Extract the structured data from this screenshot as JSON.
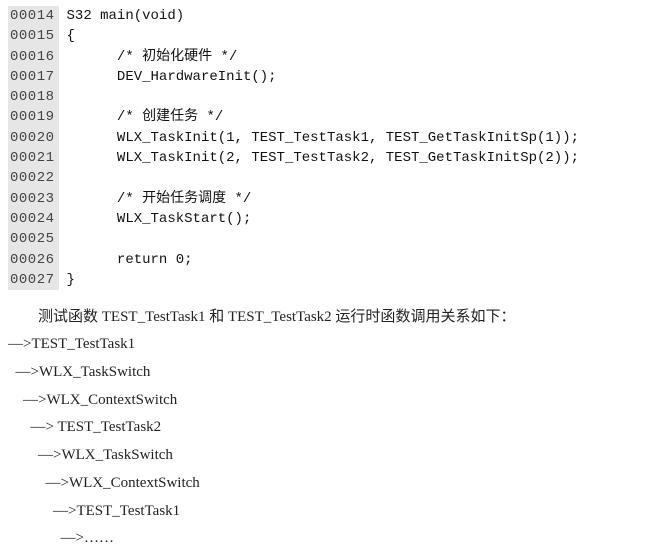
{
  "code": {
    "lines": [
      {
        "n": "00014",
        "t": "S32 main(void)"
      },
      {
        "n": "00015",
        "t": "{"
      },
      {
        "n": "00016",
        "t": "      /* 初始化硬件 */"
      },
      {
        "n": "00017",
        "t": "      DEV_HardwareInit();"
      },
      {
        "n": "00018",
        "t": ""
      },
      {
        "n": "00019",
        "t": "      /* 创建任务 */"
      },
      {
        "n": "00020",
        "t": "      WLX_TaskInit(1, TEST_TestTask1, TEST_GetTaskInitSp(1));"
      },
      {
        "n": "00021",
        "t": "      WLX_TaskInit(2, TEST_TestTask2, TEST_GetTaskInitSp(2));"
      },
      {
        "n": "00022",
        "t": ""
      },
      {
        "n": "00023",
        "t": "      /* 开始任务调度 */"
      },
      {
        "n": "00024",
        "t": "      WLX_TaskStart();"
      },
      {
        "n": "00025",
        "t": ""
      },
      {
        "n": "00026",
        "t": "      return 0;"
      },
      {
        "n": "00027",
        "t": "}"
      }
    ]
  },
  "prose": {
    "caption": "测试函数 TEST_TestTask1 和 TEST_TestTask2 运行时函数调用关系如下："
  },
  "calltree": {
    "lines": [
      "—>TEST_TestTask1",
      "  —>WLX_TaskSwitch",
      "    —>WLX_ContextSwitch",
      "      —> TEST_TestTask2",
      "        —>WLX_TaskSwitch",
      "          —>WLX_ContextSwitch",
      "            —>TEST_TestTask1",
      "              —>……"
    ]
  }
}
